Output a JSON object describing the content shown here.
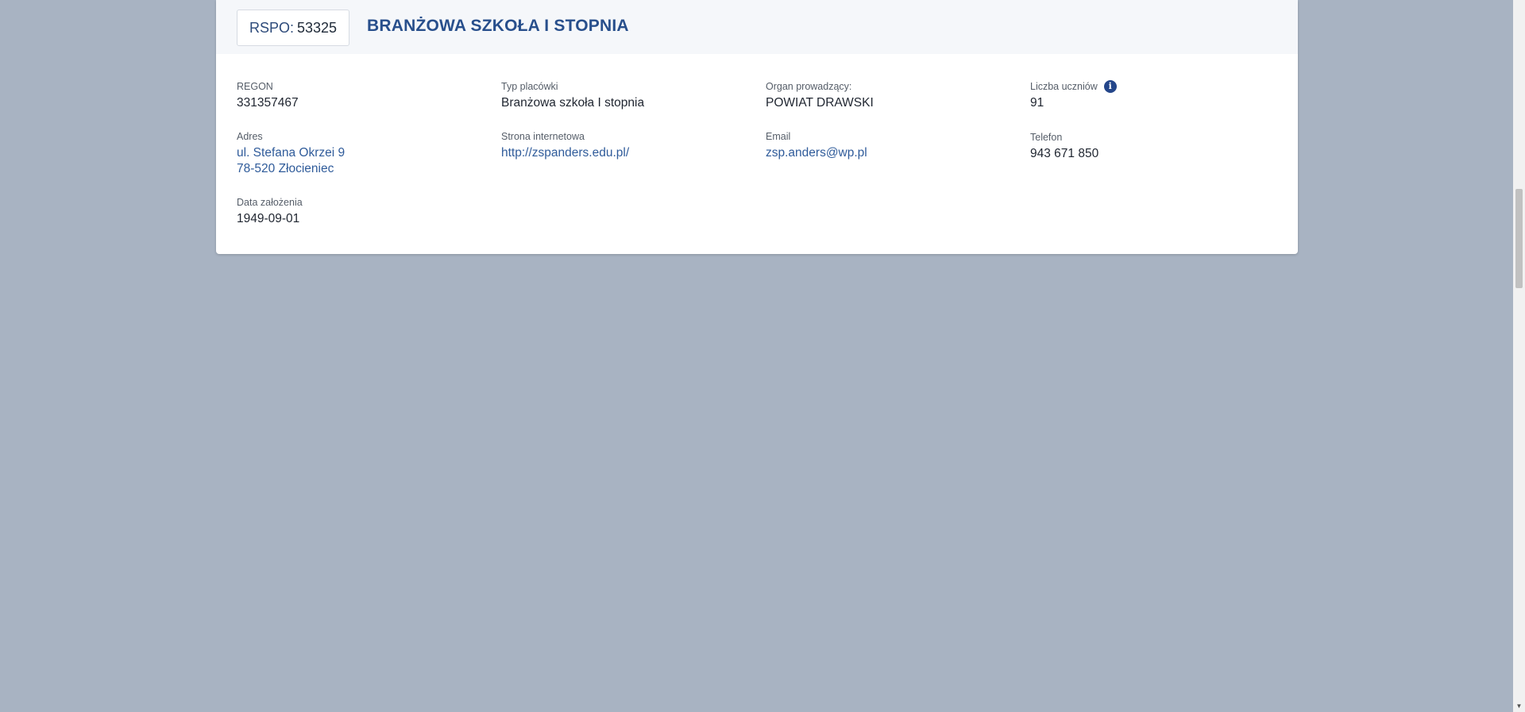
{
  "header": {
    "rspo_label": "RSPO:",
    "rspo_value": "53325",
    "school_name": "BRANŻOWA SZKOŁA I STOPNIA"
  },
  "fields": {
    "regon": {
      "label": "REGON",
      "value": "331357467"
    },
    "typ": {
      "label": "Typ placówki",
      "value": "Branżowa szkoła I stopnia"
    },
    "organ": {
      "label": "Organ prowadzący:",
      "value": "POWIAT DRAWSKI"
    },
    "liczba": {
      "label": "Liczba uczniów",
      "value": "91"
    },
    "adres": {
      "label": "Adres",
      "line1": "ul. Stefana Okrzei 9",
      "line2": "78-520 Złocieniec"
    },
    "strona": {
      "label": "Strona internetowa",
      "value": "http://zspanders.edu.pl/"
    },
    "email": {
      "label": "Email",
      "value": "zsp.anders@wp.pl"
    },
    "telefon": {
      "label": "Telefon",
      "value": "943 671 850"
    },
    "data": {
      "label": "Data założenia",
      "value": "1949-09-01"
    }
  },
  "icons": {
    "info": "info-icon",
    "scroll_down": "chevron-down-icon"
  },
  "colors": {
    "background": "#a8b3c2",
    "title": "#284f8c",
    "link": "#2f5b9a"
  }
}
